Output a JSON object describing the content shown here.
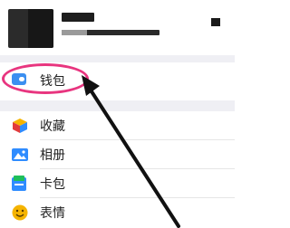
{
  "wallet": {
    "label": "钱包",
    "icon": "wallet-icon",
    "icon_color": "#3b8ff0"
  },
  "menu": [
    {
      "label": "收藏",
      "icon": "favorites-cube-icon"
    },
    {
      "label": "相册",
      "icon": "album-picture-icon"
    },
    {
      "label": "卡包",
      "icon": "card-pack-icon"
    },
    {
      "label": "表情",
      "icon": "emoji-icon"
    }
  ],
  "annotation": {
    "highlight_color": "#e8357f",
    "arrow_color": "#111111"
  }
}
